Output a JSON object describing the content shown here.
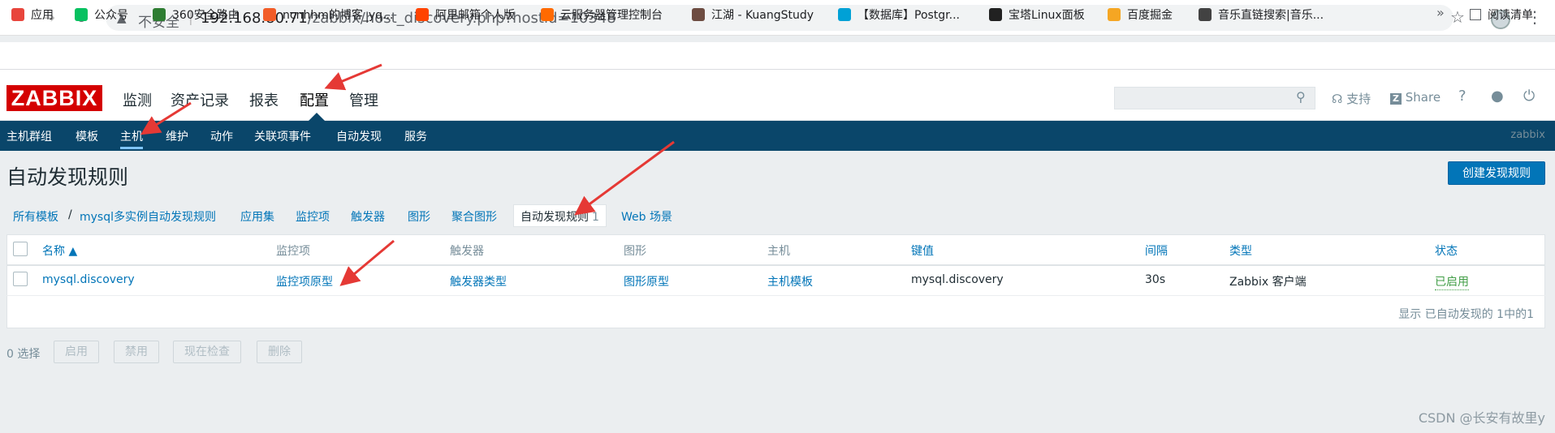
{
  "browser": {
    "insecure_label": "不安全",
    "url_host": "192.168.80.71",
    "url_path": "/zabbix/host_discovery.php?hostid=10348",
    "bookmarks": [
      {
        "label": "应用",
        "color": "#e8453c"
      },
      {
        "label": "公众号",
        "color": "#07c160"
      },
      {
        "label": "360安全路由",
        "color": "#2e7d32"
      },
      {
        "label": "ncnhhm的博客_yq...",
        "color": "#f25c27"
      },
      {
        "label": "阿里邮箱个人版",
        "color": "#ff4400"
      },
      {
        "label": "云服务器管理控制台",
        "color": "#ff6a00"
      },
      {
        "label": "江湖 - KuangStudy",
        "color": "#6d4c41"
      },
      {
        "label": "【数据库】Postgr...",
        "color": "#00a1d6"
      },
      {
        "label": "宝塔Linux面板",
        "color": "#212121"
      },
      {
        "label": "百度掘金",
        "color": "#f5a623"
      },
      {
        "label": "音乐直链搜索|音乐...",
        "color": "#424242"
      }
    ],
    "more": "»",
    "reading_list": "阅读清单"
  },
  "header": {
    "logo": "ZABBIX",
    "menu": [
      "监测",
      "资产记录",
      "报表",
      "配置",
      "管理"
    ],
    "active_menu": "配置",
    "support": "支持",
    "share": "Share",
    "help": "?",
    "search_placeholder": ""
  },
  "submenu": {
    "items": [
      "主机群组",
      "模板",
      "主机",
      "维护",
      "动作",
      "关联项事件",
      "自动发现",
      "服务"
    ],
    "active": "主机",
    "server_name": "zabbix"
  },
  "page": {
    "title": "自动发现规则",
    "create_button": "创建发现规则"
  },
  "breadcrumb": {
    "all_templates": "所有模板",
    "separator": "/",
    "template": "mysql多实例自动发现规则",
    "tabs": [
      "应用集",
      "监控项",
      "触发器",
      "图形",
      "聚合图形"
    ],
    "active_tab": "自动发现规则",
    "active_count": "1",
    "web": "Web 场景"
  },
  "table": {
    "columns": {
      "name": "名称 ▲",
      "items": "监控项",
      "triggers": "触发器",
      "graphs": "图形",
      "hosts": "主机",
      "key": "键值",
      "interval": "间隔",
      "type": "类型",
      "status": "状态"
    },
    "rows": [
      {
        "name": "mysql.discovery",
        "items": "监控项原型",
        "triggers": "触发器类型",
        "graphs": "图形原型",
        "hosts": "主机模板",
        "key": "mysql.discovery",
        "interval": "30s",
        "type": "Zabbix 客户端",
        "status": "已启用"
      }
    ],
    "footer": "显示 已自动发现的 1中的1"
  },
  "actions": {
    "selected": "0 选择",
    "buttons": [
      "启用",
      "禁用",
      "现在检查",
      "删除"
    ]
  },
  "watermark": "CSDN @长安有故里y",
  "colors": {
    "brand_red": "#d40000",
    "nav_blue": "#0a466a",
    "link_blue": "#0275b8",
    "status_green": "#429e47",
    "annotation_red": "#e53935"
  }
}
